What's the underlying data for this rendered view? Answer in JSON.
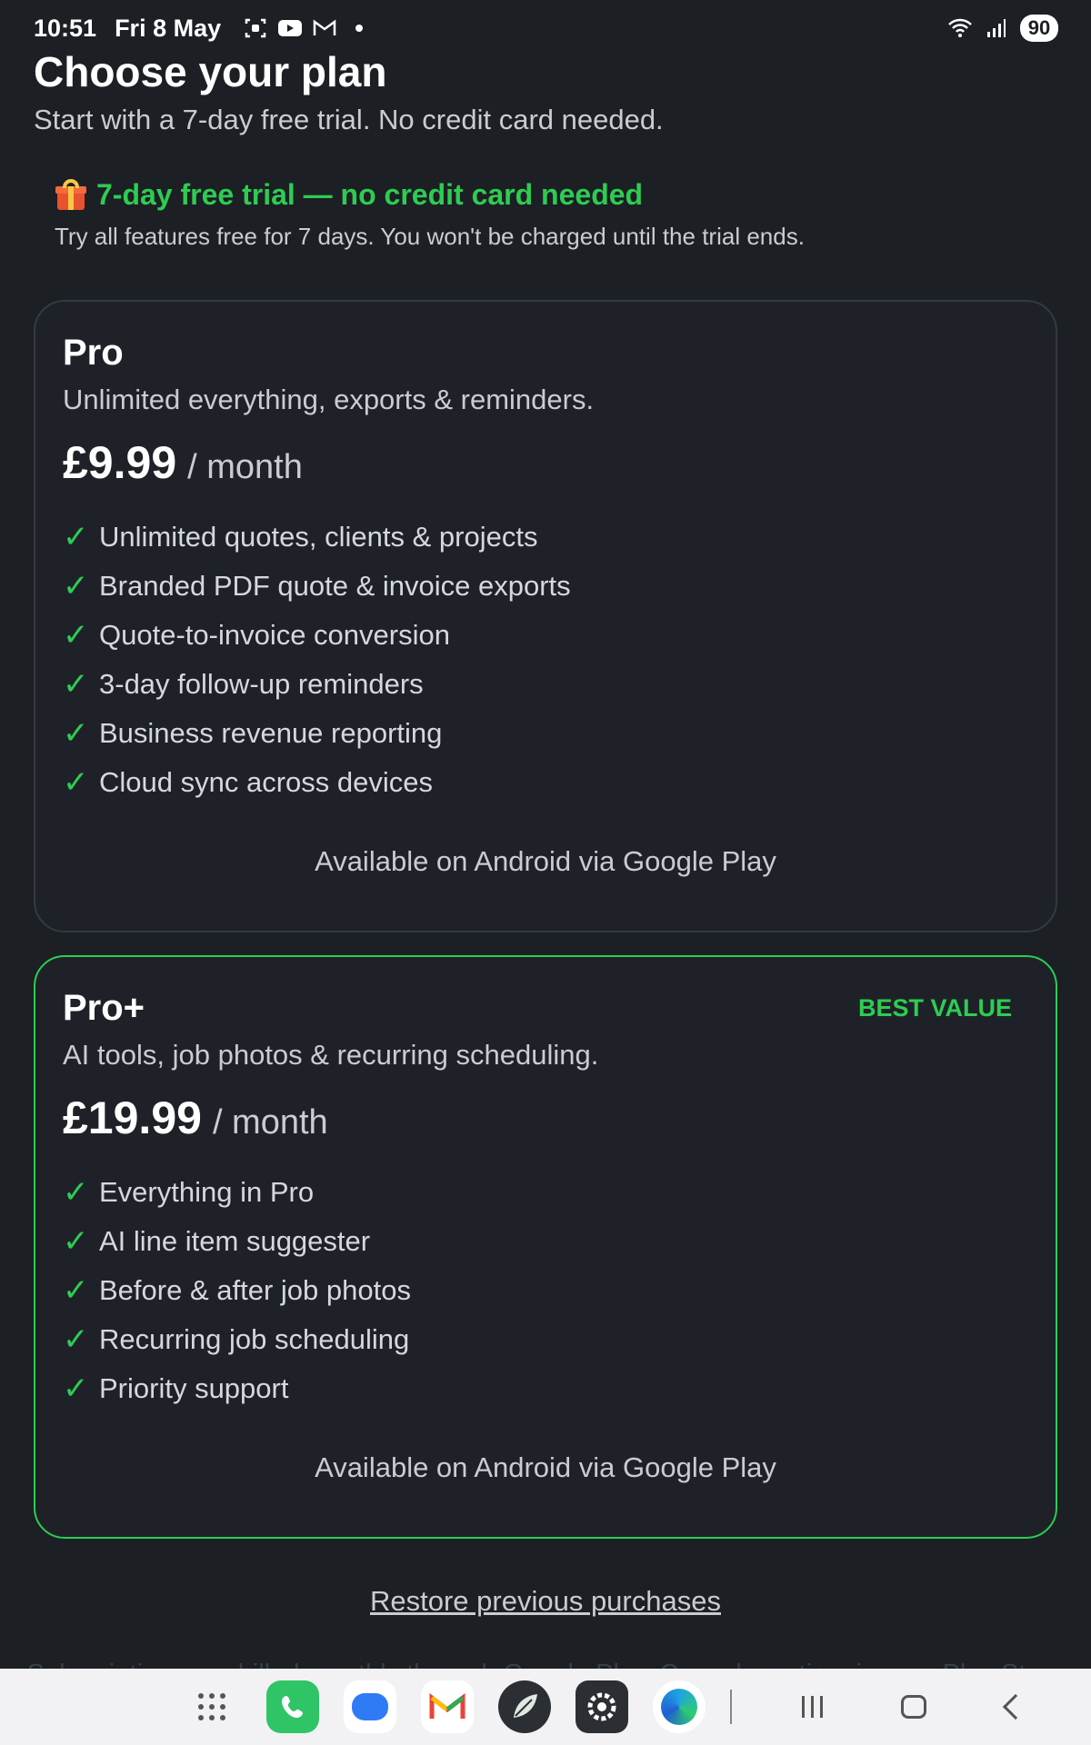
{
  "status_bar": {
    "time": "10:51",
    "date": "Fri 8 May",
    "icons": [
      "screenshot-icon",
      "youtube-icon",
      "gmail-notification-icon",
      "dot-icon"
    ],
    "battery": "90"
  },
  "header": {
    "title": "Choose your plan",
    "subtitle": "Start with a 7-day free trial. No credit card needed."
  },
  "trial_banner": {
    "title": "7-day free trial — no credit card needed",
    "description": "Try all features free for 7 days. You won't be charged until the trial ends.",
    "icon": "gift-icon",
    "accent_color": "#2ecc52"
  },
  "plans": [
    {
      "name": "Pro",
      "tagline": "Unlimited everything, exports & reminders.",
      "price": "£9.99",
      "period": "/ month",
      "features": [
        "Unlimited quotes, clients & projects",
        "Branded PDF quote & invoice exports",
        "Quote-to-invoice conversion",
        "3-day follow-up reminders",
        "Business revenue reporting",
        "Cloud sync across devices"
      ],
      "availability": "Available on Android via Google Play"
    },
    {
      "name": "Pro+",
      "badge": "BEST VALUE",
      "tagline": "AI tools, job photos & recurring scheduling.",
      "price": "£19.99",
      "period": "/ month",
      "features": [
        "Everything in Pro",
        "AI line item suggester",
        "Before & after job photos",
        "Recurring job scheduling",
        "Priority support"
      ],
      "availability": "Available on Android via Google Play"
    }
  ],
  "check_mark": "✓",
  "restore_link": "Restore previous purchases",
  "footer_note": "Subscriptions are billed monthly through Google Play. Cancel any time in your Play Store",
  "nav_bar": {
    "apps": [
      "apps-grid-icon",
      "phone-app-icon",
      "messages-app-icon",
      "gmail-app-icon",
      "leaf-app-icon",
      "settings-app-icon",
      "edge-app-icon"
    ],
    "buttons": [
      "recents-button",
      "home-button",
      "back-button"
    ]
  },
  "colors": {
    "background": "#1c1f24",
    "card": "#1e2228",
    "accent_green": "#2ecc52",
    "card_border": "#333a44"
  }
}
